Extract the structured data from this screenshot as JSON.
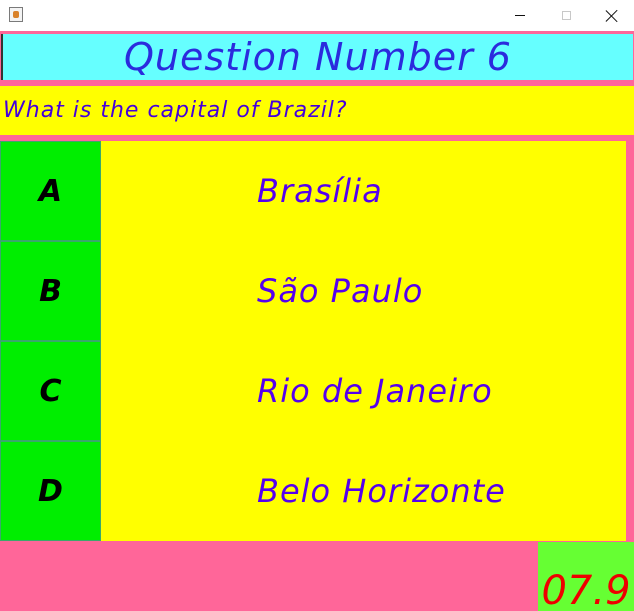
{
  "window": {
    "icon": "java-icon"
  },
  "quiz": {
    "title": "Question Number 6",
    "question": "What is the capital of Brazil?",
    "answers": [
      {
        "letter": "A",
        "text": "Brasília"
      },
      {
        "letter": "B",
        "text": "São Paulo"
      },
      {
        "letter": "C",
        "text": "Rio de Janeiro"
      },
      {
        "letter": "D",
        "text": "Belo Horizonte"
      }
    ],
    "timer": "07.9"
  },
  "colors": {
    "background": "#ff6699",
    "header_bg": "#66ffff",
    "header_text": "#2b2bdd",
    "question_bg": "#ffff00",
    "answer_text": "#5500ee",
    "letter_bg": "#00ee00",
    "timer_bg": "#66ff33",
    "timer_text": "#ee0000"
  }
}
